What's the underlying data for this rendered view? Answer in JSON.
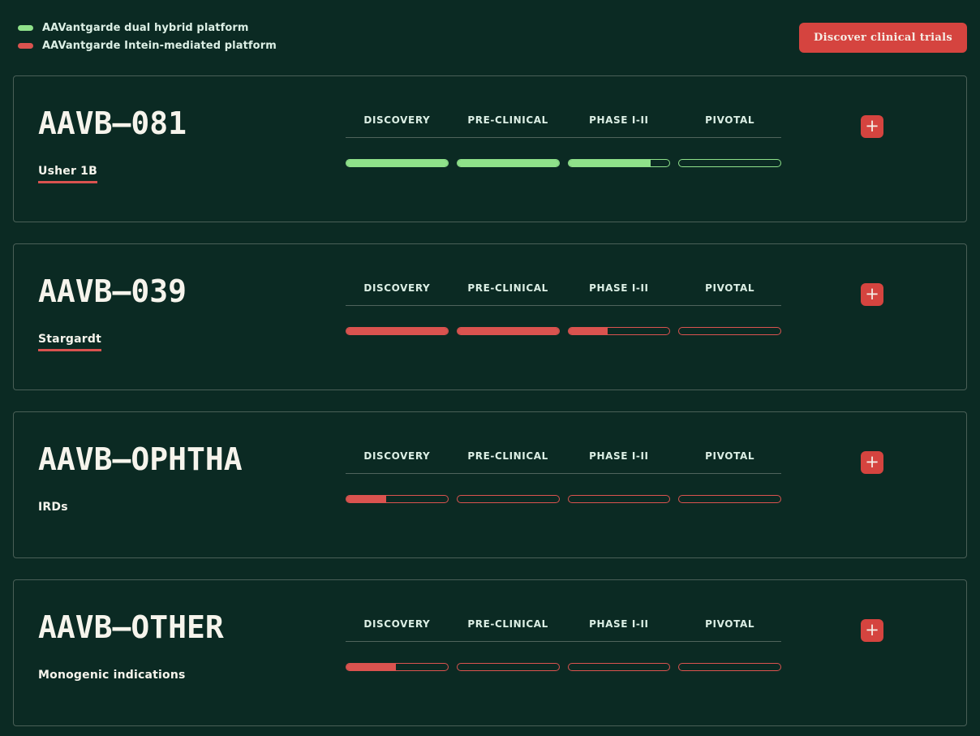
{
  "colors": {
    "background": "#0b2a23",
    "card_border": "#4a5f57",
    "divider": "#50645c",
    "title": "#f6f4ec",
    "text": "#dcefe5",
    "green": "#8fe18a",
    "red": "#da534f",
    "button_red": "#d5443f",
    "button_text": "#f6ece4"
  },
  "legend": {
    "items": [
      {
        "label": "AAVantgarde dual hybrid platform",
        "color": "#8fe18a",
        "swatch": "green-pill-icon"
      },
      {
        "label": "AAVantgarde Intein-mediated platform",
        "color": "#da534f",
        "swatch": "red-pill-icon"
      }
    ]
  },
  "header": {
    "cta_label": "Discover clinical trials"
  },
  "stage_headers": [
    "DISCOVERY",
    "PRE-CLINICAL",
    "PHASE I-II",
    "PIVOTAL"
  ],
  "programs": [
    {
      "name": "AAVB–081",
      "indication": "Usher 1B",
      "indication_underlined": true,
      "platform": "AAVantgarde dual hybrid platform",
      "bar_color": "#8fe18a",
      "progress": [
        100,
        100,
        82,
        0
      ]
    },
    {
      "name": "AAVB–039",
      "indication": "Stargardt",
      "indication_underlined": true,
      "platform": "AAVantgarde Intein-mediated platform",
      "bar_color": "#da534f",
      "progress": [
        100,
        100,
        40,
        0
      ]
    },
    {
      "name": "AAVB–OPHTHA",
      "indication": "IRDs",
      "indication_underlined": false,
      "platform": "AAVantgarde Intein-mediated platform",
      "bar_color": "#da534f",
      "progress": [
        40,
        0,
        0,
        0
      ]
    },
    {
      "name": "AAVB–OTHER",
      "indication": "Monogenic indications",
      "indication_underlined": false,
      "platform": "AAVantgarde Intein-mediated platform",
      "bar_color": "#da534f",
      "progress": [
        50,
        0,
        0,
        0
      ]
    }
  ],
  "plus_button": {
    "icon": "plus-icon",
    "glyph": "+"
  }
}
